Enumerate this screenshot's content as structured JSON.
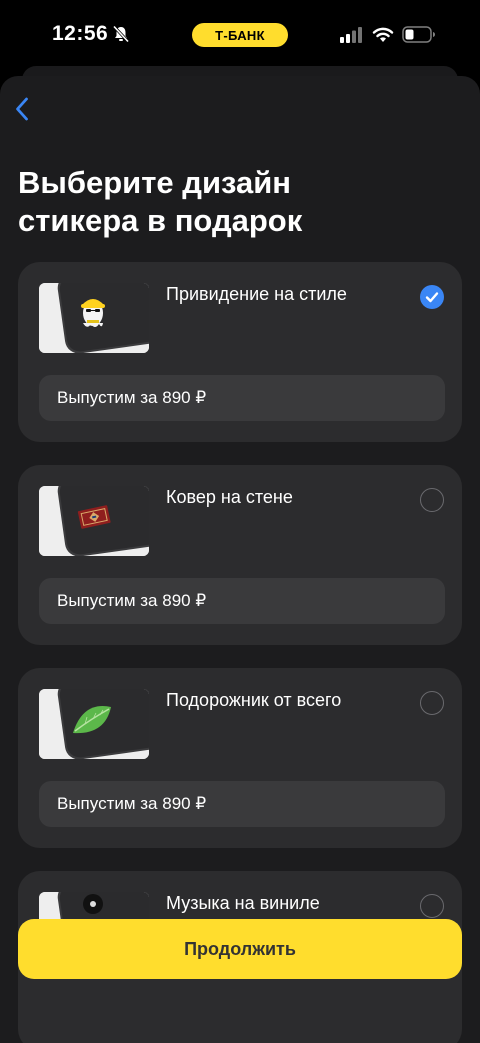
{
  "status_bar": {
    "time": "12:56",
    "bank_label": "Т-БАНК",
    "icons": [
      "bell-slash-icon",
      "signal-icon",
      "wifi-icon",
      "battery-icon"
    ]
  },
  "nav": {
    "back_icon": "chevron-left-icon"
  },
  "title": {
    "line1": "Выберите дизайн",
    "line2": "стикера в подарок"
  },
  "options": [
    {
      "label": "Привидение на стиле",
      "price_label": "Выпустим за 890 ₽",
      "selected": true,
      "sticker": "ghost"
    },
    {
      "label": "Ковер на стене",
      "price_label": "Выпустим за 890 ₽",
      "selected": false,
      "sticker": "carpet"
    },
    {
      "label": "Подорожник от всего",
      "price_label": "Выпустим за 890 ₽",
      "selected": false,
      "sticker": "leaf"
    },
    {
      "label": "Музыка на виниле",
      "selected": false,
      "sticker": "vinyl"
    }
  ],
  "continue_label": "Продолжить",
  "colors": {
    "accent_yellow": "#ffdd2d",
    "check_blue": "#3a86f5",
    "card_bg": "#2c2c2e",
    "sheet_bg": "#1c1c1e"
  }
}
